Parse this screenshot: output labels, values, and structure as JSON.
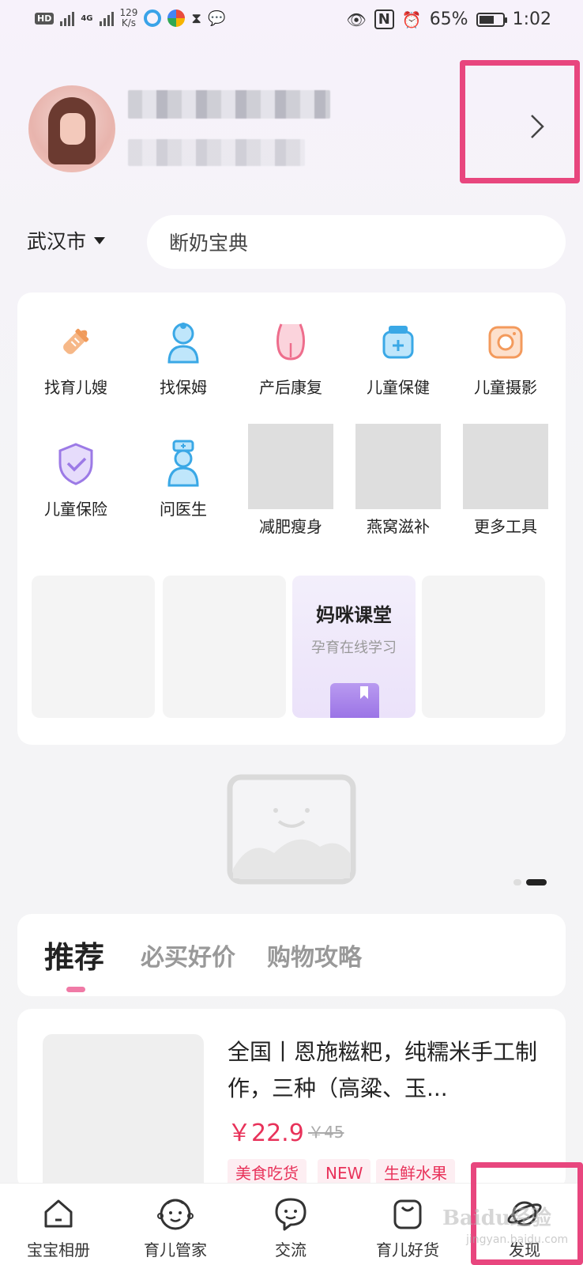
{
  "status_bar": {
    "network_badge": "HD",
    "network_type": "4G",
    "speed_value": "129",
    "speed_unit": "K/s",
    "battery": "65%",
    "battery_level": 0.65,
    "time": "1:02"
  },
  "header": {
    "location": "武汉市",
    "search_placeholder": "断奶宝典"
  },
  "tools": [
    {
      "label": "找育儿嫂",
      "icon": "baby-bottle-icon"
    },
    {
      "label": "找保姆",
      "icon": "nanny-icon"
    },
    {
      "label": "产后康复",
      "icon": "body-recovery-icon"
    },
    {
      "label": "儿童保健",
      "icon": "medicine-jar-icon"
    },
    {
      "label": "儿童摄影",
      "icon": "camera-icon"
    },
    {
      "label": "儿童保险",
      "icon": "shield-check-icon"
    },
    {
      "label": "问医生",
      "icon": "doctor-icon"
    },
    {
      "label": "减肥瘦身",
      "icon": "image-placeholder"
    },
    {
      "label": "燕窝滋补",
      "icon": "image-placeholder"
    },
    {
      "label": "更多工具",
      "icon": "image-placeholder"
    }
  ],
  "promo": {
    "title": "妈咪课堂",
    "subtitle": "孕育在线学习"
  },
  "tabs": [
    "推荐",
    "必买好价",
    "购物攻略"
  ],
  "product": {
    "title": "全国丨恩施糍粑，纯糯米手工制作，三种（高粱、玉...",
    "price": "￥22.9",
    "old_price": "￥45",
    "tags": [
      "美食吃货",
      "NEW",
      "生鲜水果"
    ]
  },
  "bottom_nav": [
    {
      "label": "宝宝相册",
      "icon": "house-icon"
    },
    {
      "label": "育儿管家",
      "icon": "baby-face-icon"
    },
    {
      "label": "交流",
      "icon": "chat-bubble-icon"
    },
    {
      "label": "育儿好货",
      "icon": "shopping-bag-icon"
    },
    {
      "label": "发现",
      "icon": "planet-icon"
    }
  ],
  "watermark": {
    "brand": "Baidu经验",
    "url": "jingyan.baidu.com"
  },
  "colors": {
    "accent_pink": "#e8467e",
    "price_red": "#e8325a",
    "tab_indicator": "#f07aa6"
  }
}
